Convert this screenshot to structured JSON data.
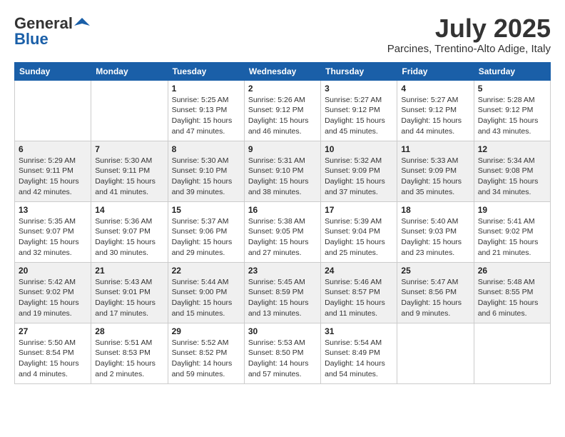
{
  "header": {
    "logo_general": "General",
    "logo_blue": "Blue",
    "month_year": "July 2025",
    "location": "Parcines, Trentino-Alto Adige, Italy"
  },
  "weekdays": [
    "Sunday",
    "Monday",
    "Tuesday",
    "Wednesday",
    "Thursday",
    "Friday",
    "Saturday"
  ],
  "weeks": [
    [
      {
        "day": "",
        "info": ""
      },
      {
        "day": "",
        "info": ""
      },
      {
        "day": "1",
        "info": "Sunrise: 5:25 AM\nSunset: 9:13 PM\nDaylight: 15 hours\nand 47 minutes."
      },
      {
        "day": "2",
        "info": "Sunrise: 5:26 AM\nSunset: 9:12 PM\nDaylight: 15 hours\nand 46 minutes."
      },
      {
        "day": "3",
        "info": "Sunrise: 5:27 AM\nSunset: 9:12 PM\nDaylight: 15 hours\nand 45 minutes."
      },
      {
        "day": "4",
        "info": "Sunrise: 5:27 AM\nSunset: 9:12 PM\nDaylight: 15 hours\nand 44 minutes."
      },
      {
        "day": "5",
        "info": "Sunrise: 5:28 AM\nSunset: 9:12 PM\nDaylight: 15 hours\nand 43 minutes."
      }
    ],
    [
      {
        "day": "6",
        "info": "Sunrise: 5:29 AM\nSunset: 9:11 PM\nDaylight: 15 hours\nand 42 minutes."
      },
      {
        "day": "7",
        "info": "Sunrise: 5:30 AM\nSunset: 9:11 PM\nDaylight: 15 hours\nand 41 minutes."
      },
      {
        "day": "8",
        "info": "Sunrise: 5:30 AM\nSunset: 9:10 PM\nDaylight: 15 hours\nand 39 minutes."
      },
      {
        "day": "9",
        "info": "Sunrise: 5:31 AM\nSunset: 9:10 PM\nDaylight: 15 hours\nand 38 minutes."
      },
      {
        "day": "10",
        "info": "Sunrise: 5:32 AM\nSunset: 9:09 PM\nDaylight: 15 hours\nand 37 minutes."
      },
      {
        "day": "11",
        "info": "Sunrise: 5:33 AM\nSunset: 9:09 PM\nDaylight: 15 hours\nand 35 minutes."
      },
      {
        "day": "12",
        "info": "Sunrise: 5:34 AM\nSunset: 9:08 PM\nDaylight: 15 hours\nand 34 minutes."
      }
    ],
    [
      {
        "day": "13",
        "info": "Sunrise: 5:35 AM\nSunset: 9:07 PM\nDaylight: 15 hours\nand 32 minutes."
      },
      {
        "day": "14",
        "info": "Sunrise: 5:36 AM\nSunset: 9:07 PM\nDaylight: 15 hours\nand 30 minutes."
      },
      {
        "day": "15",
        "info": "Sunrise: 5:37 AM\nSunset: 9:06 PM\nDaylight: 15 hours\nand 29 minutes."
      },
      {
        "day": "16",
        "info": "Sunrise: 5:38 AM\nSunset: 9:05 PM\nDaylight: 15 hours\nand 27 minutes."
      },
      {
        "day": "17",
        "info": "Sunrise: 5:39 AM\nSunset: 9:04 PM\nDaylight: 15 hours\nand 25 minutes."
      },
      {
        "day": "18",
        "info": "Sunrise: 5:40 AM\nSunset: 9:03 PM\nDaylight: 15 hours\nand 23 minutes."
      },
      {
        "day": "19",
        "info": "Sunrise: 5:41 AM\nSunset: 9:02 PM\nDaylight: 15 hours\nand 21 minutes."
      }
    ],
    [
      {
        "day": "20",
        "info": "Sunrise: 5:42 AM\nSunset: 9:02 PM\nDaylight: 15 hours\nand 19 minutes."
      },
      {
        "day": "21",
        "info": "Sunrise: 5:43 AM\nSunset: 9:01 PM\nDaylight: 15 hours\nand 17 minutes."
      },
      {
        "day": "22",
        "info": "Sunrise: 5:44 AM\nSunset: 9:00 PM\nDaylight: 15 hours\nand 15 minutes."
      },
      {
        "day": "23",
        "info": "Sunrise: 5:45 AM\nSunset: 8:59 PM\nDaylight: 15 hours\nand 13 minutes."
      },
      {
        "day": "24",
        "info": "Sunrise: 5:46 AM\nSunset: 8:57 PM\nDaylight: 15 hours\nand 11 minutes."
      },
      {
        "day": "25",
        "info": "Sunrise: 5:47 AM\nSunset: 8:56 PM\nDaylight: 15 hours\nand 9 minutes."
      },
      {
        "day": "26",
        "info": "Sunrise: 5:48 AM\nSunset: 8:55 PM\nDaylight: 15 hours\nand 6 minutes."
      }
    ],
    [
      {
        "day": "27",
        "info": "Sunrise: 5:50 AM\nSunset: 8:54 PM\nDaylight: 15 hours\nand 4 minutes."
      },
      {
        "day": "28",
        "info": "Sunrise: 5:51 AM\nSunset: 8:53 PM\nDaylight: 15 hours\nand 2 minutes."
      },
      {
        "day": "29",
        "info": "Sunrise: 5:52 AM\nSunset: 8:52 PM\nDaylight: 14 hours\nand 59 minutes."
      },
      {
        "day": "30",
        "info": "Sunrise: 5:53 AM\nSunset: 8:50 PM\nDaylight: 14 hours\nand 57 minutes."
      },
      {
        "day": "31",
        "info": "Sunrise: 5:54 AM\nSunset: 8:49 PM\nDaylight: 14 hours\nand 54 minutes."
      },
      {
        "day": "",
        "info": ""
      },
      {
        "day": "",
        "info": ""
      }
    ]
  ]
}
